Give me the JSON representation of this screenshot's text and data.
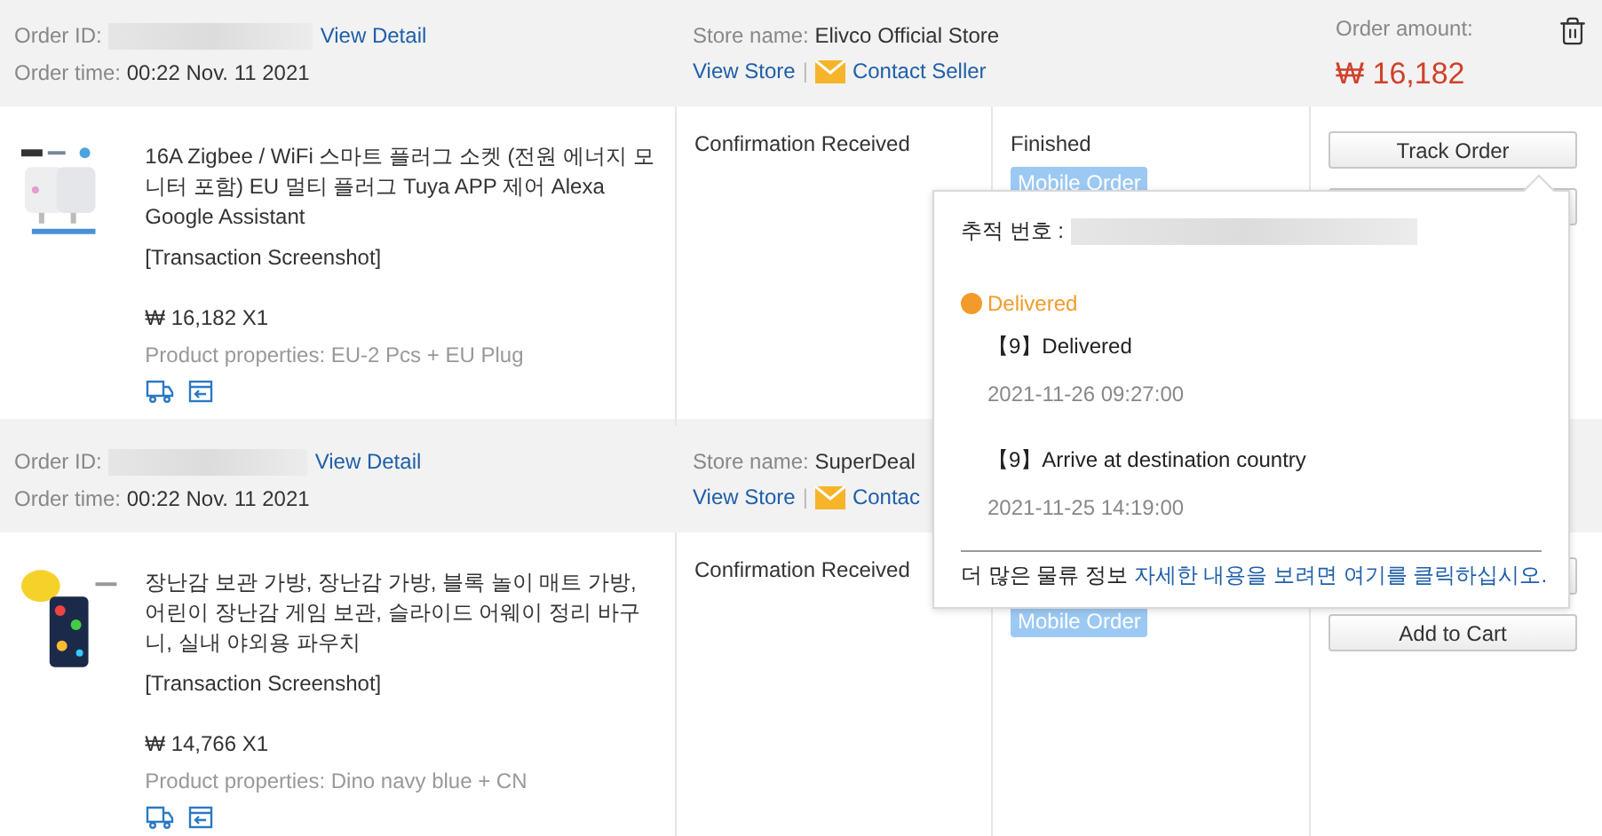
{
  "orders": [
    {
      "order_id_label": "Order ID:",
      "view_detail": "View Detail",
      "order_time_label": "Order time:",
      "order_time": "00:22 Nov. 11 2021",
      "store_label": "Store name:",
      "store_name": "Elivco Official Store",
      "view_store": "View Store",
      "separator": "|",
      "contact": "Contact Seller",
      "amount_label": "Order amount:",
      "amount": "₩ 16,182",
      "item": {
        "title": "16A Zigbee / WiFi 스마트 플러그 소켓 (전원 에너지 모니터 포함) EU 멀티 플러그 Tuya APP 제어 Alexa Google Assistant",
        "screenshot": "[Transaction Screenshot]",
        "price": "₩ 16,182 X1",
        "properties": "Product properties: EU-2 Pcs + EU Plug"
      },
      "confirmation": "Confirmation Received",
      "status": "Finished",
      "badge": "Mobile Order",
      "buttons": [
        {
          "kind": "text",
          "label": "Track Order"
        },
        {
          "kind": "blank"
        }
      ]
    },
    {
      "order_id_label": "Order ID:",
      "view_detail": "View Detail",
      "order_time_label": "Order time:",
      "order_time": "00:22 Nov. 11 2021",
      "store_label": "Store name:",
      "store_name": "SuperDeal",
      "view_store": "View Store",
      "separator": "|",
      "contact": "Contac",
      "item": {
        "title": "장난감 보관 가방, 장난감 가방, 블록 놀이 매트 가방, 어린이 장난감 게임 보관, 슬라이드 어웨이 정리 바구니, 실내 야외용 파우치",
        "screenshot": "[Transaction Screenshot]",
        "price": "₩ 14,766 X1",
        "properties": "Product properties: Dino navy blue + CN"
      },
      "confirmation": "Confirmation Received",
      "badge": "Mobile Order",
      "buttons": [
        {
          "kind": "blank"
        },
        {
          "kind": "text",
          "label": "Add to Cart"
        }
      ]
    }
  ],
  "tracking_popup": {
    "label": "추적 번호 :",
    "current_status": "Delivered",
    "events": [
      {
        "title": "【9】Delivered",
        "time": "2021-11-26 09:27:00"
      },
      {
        "title": "【9】Arrive at destination country",
        "time": "2021-11-25 14:19:00"
      }
    ],
    "footer_text": "더 많은 물류 정보",
    "footer_link": "자세한 내용을 보려면 여기를 클릭하십시오."
  }
}
